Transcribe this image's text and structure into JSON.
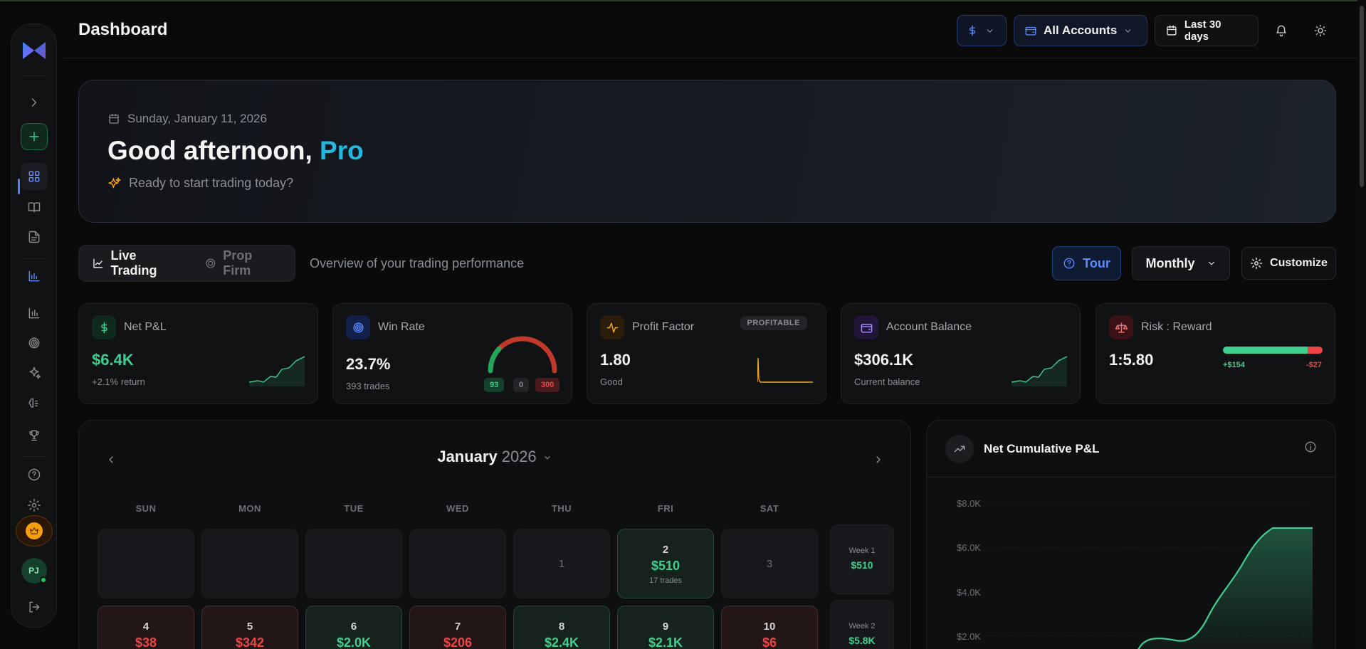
{
  "header": {
    "title": "Dashboard",
    "accounts_label": "All Accounts",
    "date_range_label": "Last 30 days"
  },
  "hero": {
    "date": "Sunday, January 11, 2026",
    "greeting": "Good afternoon,",
    "name": "Pro",
    "subtitle": "Ready to start trading today?"
  },
  "tabs": [
    {
      "label": "Live Trading",
      "active": true
    },
    {
      "label": "Prop Firm",
      "active": false
    }
  ],
  "overview_text": "Overview of your trading performance",
  "toolbar": {
    "tour_label": "Tour",
    "period_label": "Monthly",
    "customize_label": "Customize"
  },
  "stats": {
    "net_pnl": {
      "label": "Net P&L",
      "value": "$6.4K",
      "sub": "+2.1% return"
    },
    "win_rate": {
      "label": "Win Rate",
      "value": "23.7%",
      "sub": "393 trades",
      "wins": "93",
      "breakeven": "0",
      "losses": "300",
      "fraction": 0.237
    },
    "profit_factor": {
      "label": "Profit Factor",
      "value": "1.80",
      "sub": "Good",
      "badge": "PROFITABLE"
    },
    "account_balance": {
      "label": "Account Balance",
      "value": "$306.1K",
      "sub": "Current balance"
    },
    "risk_reward": {
      "label": "Risk : Reward",
      "value": "1:5.80",
      "win_amount": "+$154",
      "loss_amount": "-$27",
      "fraction": 0.85
    }
  },
  "calendar": {
    "month": "January",
    "year": "2026",
    "weekdays": [
      "SUN",
      "MON",
      "TUE",
      "WED",
      "THU",
      "FRI",
      "SAT"
    ],
    "row1": [
      {
        "day": "",
        "value": "",
        "trades": "",
        "kind": "empty"
      },
      {
        "day": "",
        "value": "",
        "trades": "",
        "kind": "empty"
      },
      {
        "day": "",
        "value": "",
        "trades": "",
        "kind": "empty"
      },
      {
        "day": "",
        "value": "",
        "trades": "",
        "kind": "empty"
      },
      {
        "day": "1",
        "value": "",
        "trades": "",
        "kind": "muted"
      },
      {
        "day": "2",
        "value": "$510",
        "trades": "17 trades",
        "kind": "green"
      },
      {
        "day": "3",
        "value": "",
        "trades": "",
        "kind": "muted"
      }
    ],
    "row2": [
      {
        "day": "4",
        "value": "$38",
        "kind": "red"
      },
      {
        "day": "5",
        "value": "$342",
        "kind": "red"
      },
      {
        "day": "6",
        "value": "$2.0K",
        "kind": "green"
      },
      {
        "day": "7",
        "value": "$206",
        "kind": "red"
      },
      {
        "day": "8",
        "value": "$2.4K",
        "kind": "green"
      },
      {
        "day": "9",
        "value": "$2.1K",
        "kind": "green"
      },
      {
        "day": "10",
        "value": "$6",
        "kind": "red"
      }
    ],
    "weeks": [
      {
        "label": "Week 1",
        "value": "$510"
      },
      {
        "label": "Week 2",
        "value": "$5.8K"
      }
    ]
  },
  "net_cumulative": {
    "title": "Net Cumulative P&L",
    "y_ticks": [
      "$8.0K",
      "$6.0K",
      "$4.0K",
      "$2.0K"
    ]
  },
  "colors": {
    "accent_blue": "#5b8cff",
    "profit_green": "#3fcf8e",
    "loss_red": "#ef4444",
    "name_cyan": "#22b8e0"
  }
}
